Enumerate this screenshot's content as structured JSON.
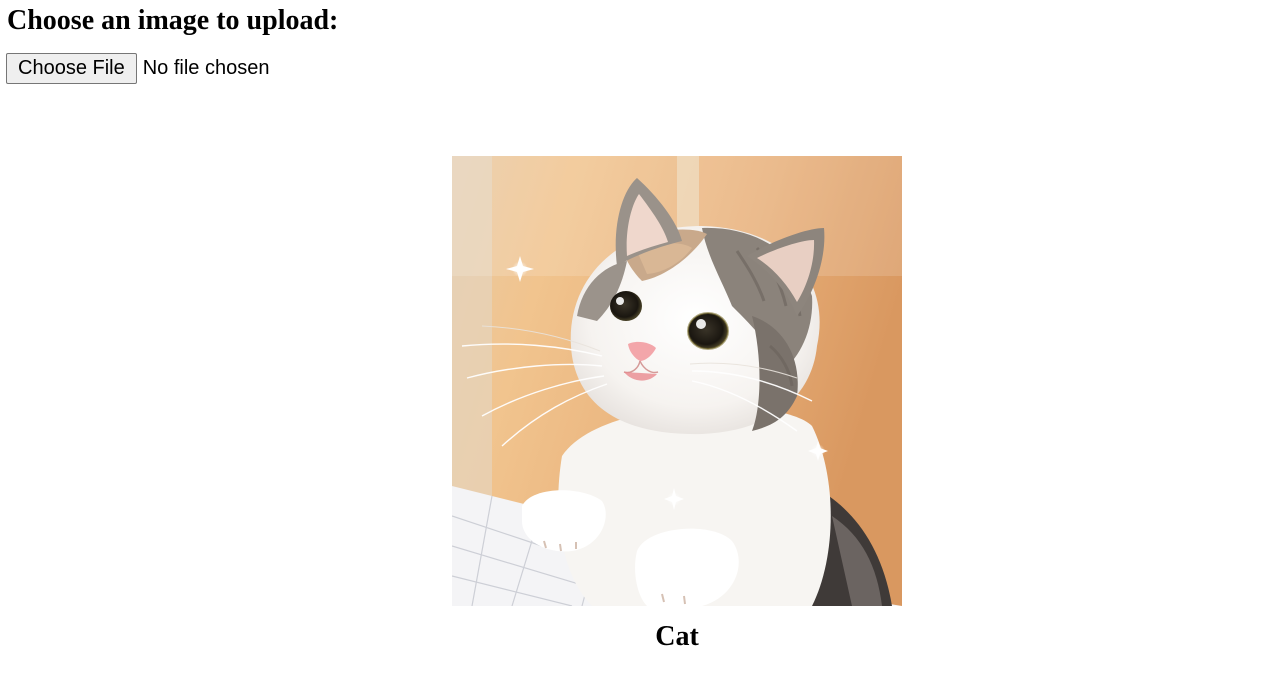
{
  "header": {
    "title": "Choose an image to upload:"
  },
  "upload": {
    "button_label": "Choose File",
    "status_text": "No file chosen"
  },
  "result": {
    "image_icon": "cat-photo",
    "label": "Cat"
  }
}
